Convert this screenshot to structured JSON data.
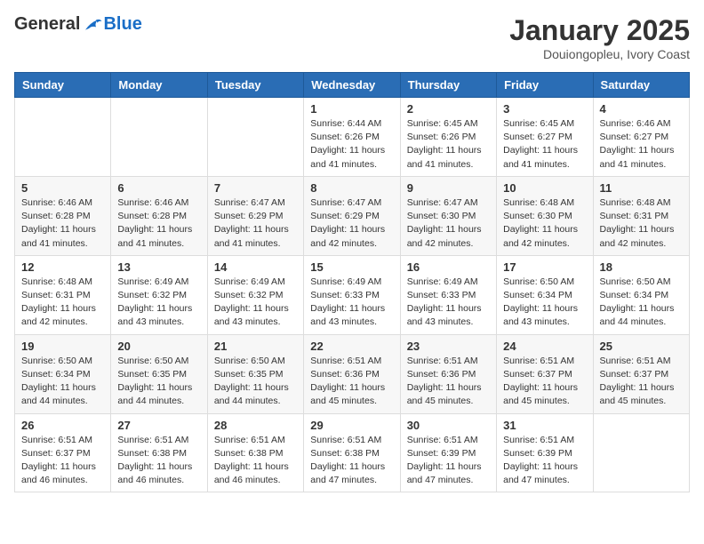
{
  "logo": {
    "general": "General",
    "blue": "Blue"
  },
  "header": {
    "month": "January 2025",
    "location": "Douiongopleu, Ivory Coast"
  },
  "days_of_week": [
    "Sunday",
    "Monday",
    "Tuesday",
    "Wednesday",
    "Thursday",
    "Friday",
    "Saturday"
  ],
  "weeks": [
    [
      {
        "day": "",
        "info": ""
      },
      {
        "day": "",
        "info": ""
      },
      {
        "day": "",
        "info": ""
      },
      {
        "day": "1",
        "info": "Sunrise: 6:44 AM\nSunset: 6:26 PM\nDaylight: 11 hours and 41 minutes."
      },
      {
        "day": "2",
        "info": "Sunrise: 6:45 AM\nSunset: 6:26 PM\nDaylight: 11 hours and 41 minutes."
      },
      {
        "day": "3",
        "info": "Sunrise: 6:45 AM\nSunset: 6:27 PM\nDaylight: 11 hours and 41 minutes."
      },
      {
        "day": "4",
        "info": "Sunrise: 6:46 AM\nSunset: 6:27 PM\nDaylight: 11 hours and 41 minutes."
      }
    ],
    [
      {
        "day": "5",
        "info": "Sunrise: 6:46 AM\nSunset: 6:28 PM\nDaylight: 11 hours and 41 minutes."
      },
      {
        "day": "6",
        "info": "Sunrise: 6:46 AM\nSunset: 6:28 PM\nDaylight: 11 hours and 41 minutes."
      },
      {
        "day": "7",
        "info": "Sunrise: 6:47 AM\nSunset: 6:29 PM\nDaylight: 11 hours and 41 minutes."
      },
      {
        "day": "8",
        "info": "Sunrise: 6:47 AM\nSunset: 6:29 PM\nDaylight: 11 hours and 42 minutes."
      },
      {
        "day": "9",
        "info": "Sunrise: 6:47 AM\nSunset: 6:30 PM\nDaylight: 11 hours and 42 minutes."
      },
      {
        "day": "10",
        "info": "Sunrise: 6:48 AM\nSunset: 6:30 PM\nDaylight: 11 hours and 42 minutes."
      },
      {
        "day": "11",
        "info": "Sunrise: 6:48 AM\nSunset: 6:31 PM\nDaylight: 11 hours and 42 minutes."
      }
    ],
    [
      {
        "day": "12",
        "info": "Sunrise: 6:48 AM\nSunset: 6:31 PM\nDaylight: 11 hours and 42 minutes."
      },
      {
        "day": "13",
        "info": "Sunrise: 6:49 AM\nSunset: 6:32 PM\nDaylight: 11 hours and 43 minutes."
      },
      {
        "day": "14",
        "info": "Sunrise: 6:49 AM\nSunset: 6:32 PM\nDaylight: 11 hours and 43 minutes."
      },
      {
        "day": "15",
        "info": "Sunrise: 6:49 AM\nSunset: 6:33 PM\nDaylight: 11 hours and 43 minutes."
      },
      {
        "day": "16",
        "info": "Sunrise: 6:49 AM\nSunset: 6:33 PM\nDaylight: 11 hours and 43 minutes."
      },
      {
        "day": "17",
        "info": "Sunrise: 6:50 AM\nSunset: 6:34 PM\nDaylight: 11 hours and 43 minutes."
      },
      {
        "day": "18",
        "info": "Sunrise: 6:50 AM\nSunset: 6:34 PM\nDaylight: 11 hours and 44 minutes."
      }
    ],
    [
      {
        "day": "19",
        "info": "Sunrise: 6:50 AM\nSunset: 6:34 PM\nDaylight: 11 hours and 44 minutes."
      },
      {
        "day": "20",
        "info": "Sunrise: 6:50 AM\nSunset: 6:35 PM\nDaylight: 11 hours and 44 minutes."
      },
      {
        "day": "21",
        "info": "Sunrise: 6:50 AM\nSunset: 6:35 PM\nDaylight: 11 hours and 44 minutes."
      },
      {
        "day": "22",
        "info": "Sunrise: 6:51 AM\nSunset: 6:36 PM\nDaylight: 11 hours and 45 minutes."
      },
      {
        "day": "23",
        "info": "Sunrise: 6:51 AM\nSunset: 6:36 PM\nDaylight: 11 hours and 45 minutes."
      },
      {
        "day": "24",
        "info": "Sunrise: 6:51 AM\nSunset: 6:37 PM\nDaylight: 11 hours and 45 minutes."
      },
      {
        "day": "25",
        "info": "Sunrise: 6:51 AM\nSunset: 6:37 PM\nDaylight: 11 hours and 45 minutes."
      }
    ],
    [
      {
        "day": "26",
        "info": "Sunrise: 6:51 AM\nSunset: 6:37 PM\nDaylight: 11 hours and 46 minutes."
      },
      {
        "day": "27",
        "info": "Sunrise: 6:51 AM\nSunset: 6:38 PM\nDaylight: 11 hours and 46 minutes."
      },
      {
        "day": "28",
        "info": "Sunrise: 6:51 AM\nSunset: 6:38 PM\nDaylight: 11 hours and 46 minutes."
      },
      {
        "day": "29",
        "info": "Sunrise: 6:51 AM\nSunset: 6:38 PM\nDaylight: 11 hours and 47 minutes."
      },
      {
        "day": "30",
        "info": "Sunrise: 6:51 AM\nSunset: 6:39 PM\nDaylight: 11 hours and 47 minutes."
      },
      {
        "day": "31",
        "info": "Sunrise: 6:51 AM\nSunset: 6:39 PM\nDaylight: 11 hours and 47 minutes."
      },
      {
        "day": "",
        "info": ""
      }
    ]
  ]
}
